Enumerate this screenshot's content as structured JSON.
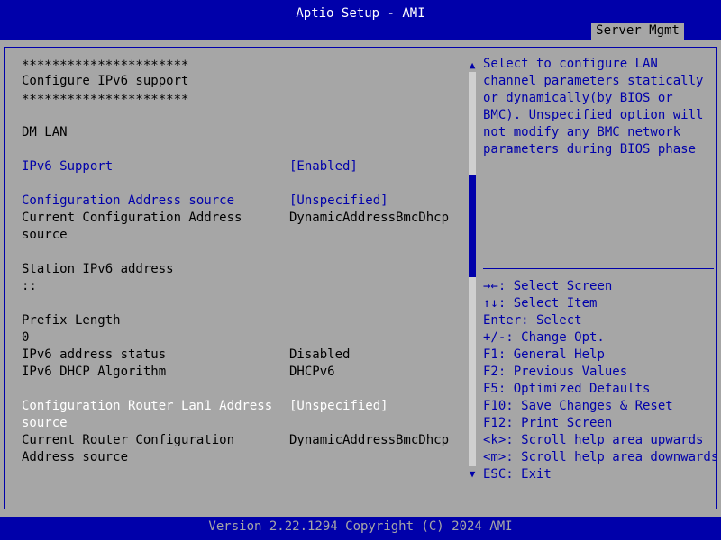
{
  "header": {
    "title": "Aptio Setup - AMI",
    "tab": "Server Mgmt"
  },
  "main": {
    "stars_top": "**********************",
    "section_title": "Configure IPv6 support",
    "stars_bottom": "**********************",
    "group_label": "DM_LAN",
    "ipv6_support": {
      "label": "IPv6 Support",
      "value": "[Enabled]"
    },
    "config_address_source": {
      "label": "Configuration Address source",
      "value": "[Unspecified]"
    },
    "current_config_address": {
      "label_line1": "Current Configuration Address",
      "label_line2": "source",
      "value": "DynamicAddressBmcDhcp"
    },
    "station_ipv6": {
      "label": "Station IPv6 address",
      "value": "::"
    },
    "prefix_length": {
      "label": "Prefix Length",
      "value": "0"
    },
    "ipv6_status": {
      "label": "IPv6 address status",
      "value": "Disabled"
    },
    "ipv6_dhcp": {
      "label": "IPv6 DHCP Algorithm",
      "value": "DHCPv6"
    },
    "config_router_lan1": {
      "label_line1": "Configuration Router Lan1 Address",
      "label_line2": "source",
      "value": "[Unspecified]"
    },
    "current_router_config": {
      "label_line1": "Current Router Configuration",
      "label_line2": "Address source",
      "value": "DynamicAddressBmcDhcp"
    }
  },
  "help": {
    "lines": [
      "Select to configure LAN",
      "channel parameters statically",
      "or dynamically(by BIOS or",
      "BMC). Unspecified option will",
      "not modify any BMC network",
      "parameters during BIOS phase"
    ]
  },
  "keys": [
    {
      "key": "→←:",
      "desc": " Select Screen"
    },
    {
      "key": "↑↓:",
      "desc": " Select Item"
    },
    {
      "key": "Enter:",
      "desc": " Select"
    },
    {
      "key": "+/-:",
      "desc": " Change Opt."
    },
    {
      "key": "F1:",
      "desc": " General Help"
    },
    {
      "key": "F2:",
      "desc": " Previous Values"
    },
    {
      "key": "F5:",
      "desc": " Optimized Defaults"
    },
    {
      "key": "F10:",
      "desc": " Save Changes & Reset"
    },
    {
      "key": "F12:",
      "desc": " Print Screen"
    },
    {
      "key": "<k>:",
      "desc": " Scroll help area upwards"
    },
    {
      "key": "<m>:",
      "desc": " Scroll help area downwards"
    },
    {
      "key": "ESC:",
      "desc": " Exit"
    }
  ],
  "scroll": {
    "up_icon": "▲",
    "down_icon": "▼"
  },
  "footer": {
    "text": "Version 2.22.1294 Copyright (C) 2024 AMI"
  },
  "colors": {
    "bg": "#a6a6a6",
    "bar": "#0000aa",
    "selected": "#ffffff"
  }
}
